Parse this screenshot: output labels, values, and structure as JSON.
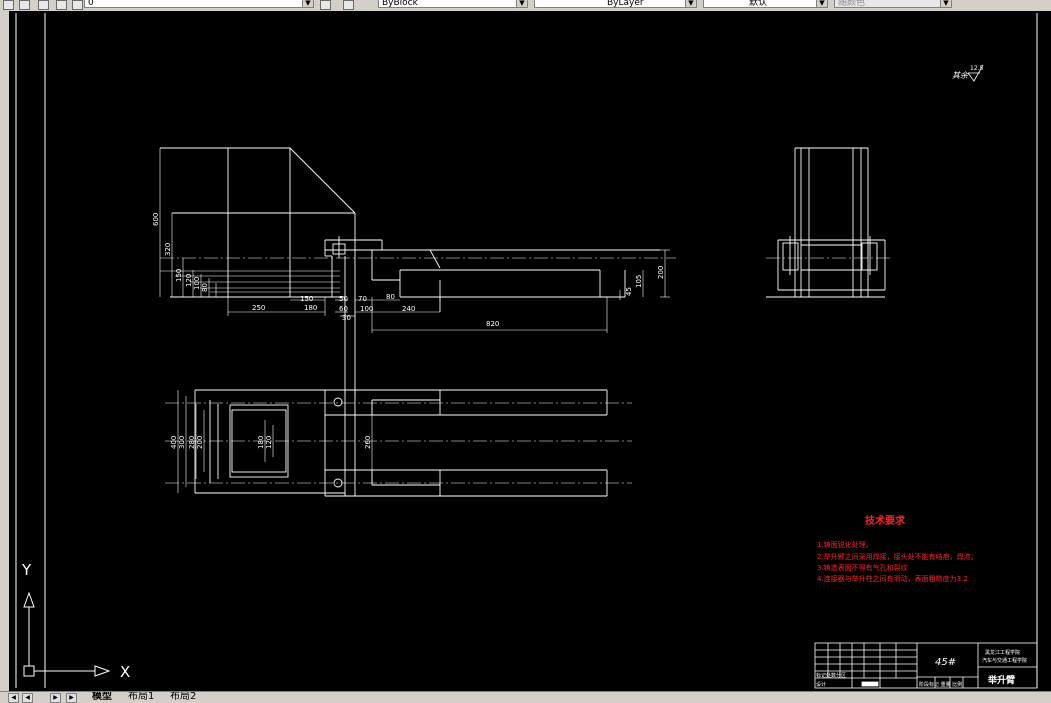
{
  "toolbar": {
    "layer_value": "0",
    "color_value": "ByBlock",
    "linetype_value": "ByLayer",
    "lineweight_value": "默认",
    "plotstyle_value": "随颜色"
  },
  "drawing": {
    "roughness_label": "其余",
    "roughness_value": "12.5",
    "tech_title": "技术要求",
    "tech_notes": [
      "1.铸面锐化处理。",
      "2.举升臂之间采用焊接，接头处不能有结疤，焊渣。",
      "3.铸造表面不得有气孔和裂纹",
      "4.连接器与举升柱之间有滑动，表面粗糙度为3.2"
    ],
    "dims": {
      "d600": "600",
      "d320": "320",
      "d150v": "150",
      "d120": "120",
      "d100": "100",
      "d80": "80",
      "d200r": "200",
      "d105": "105",
      "d45": "45",
      "d250": "250",
      "d150h": "150",
      "d180": "180",
      "d50": "50",
      "d70": "70",
      "d60": "60",
      "d100h": "100",
      "d240": "240",
      "d30": "30",
      "d820": "820",
      "d400": "400",
      "d300": "300",
      "d280": "280",
      "d200": "200",
      "d180v": "180",
      "d260": "260"
    },
    "title_block": {
      "material": "45#",
      "school_line1": "黑龙江工程学院",
      "school_line2": "汽车与交通工程学院",
      "part_name": "举升臂",
      "row_label_1": "标记处数分区",
      "row_label_2": "设计",
      "row_label_3": "阶段标记 重量 比例"
    },
    "ucs": {
      "y_label": "Y",
      "x_label": "X"
    }
  },
  "tabs": {
    "model": "模型",
    "layout1": "布局1",
    "layout2": "布局2"
  }
}
